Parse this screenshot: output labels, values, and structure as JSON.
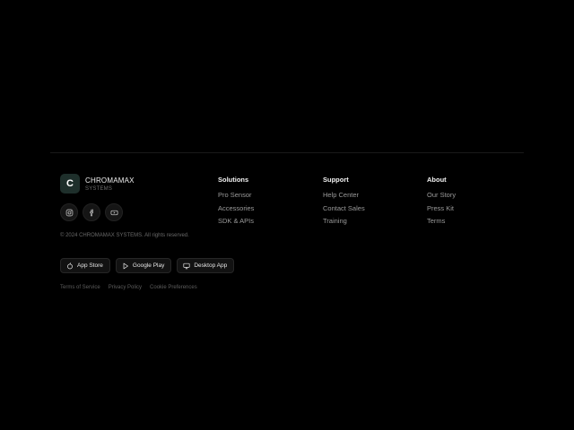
{
  "brand": {
    "mark": "C",
    "name": "CHROMAMAX",
    "sub": "SYSTEMS"
  },
  "socials": [
    {
      "icon": "instagram-icon"
    },
    {
      "icon": "facebook-icon"
    },
    {
      "icon": "youtube-icon"
    }
  ],
  "copyright": "© 2024 CHROMAMAX SYSTEMS. All rights reserved.",
  "columns": [
    {
      "title": "Solutions",
      "links": [
        "Pro Sensor",
        "Accessories",
        "SDK & APIs"
      ]
    },
    {
      "title": "Support",
      "links": [
        "Help Center",
        "Contact Sales",
        "Training"
      ]
    },
    {
      "title": "About",
      "links": [
        "Our Story",
        "Press Kit",
        "Terms"
      ]
    }
  ],
  "apps": [
    {
      "label": "App Store",
      "icon": "apple-icon"
    },
    {
      "label": "Google Play",
      "icon": "play-icon"
    },
    {
      "label": "Desktop App",
      "icon": "monitor-icon"
    }
  ],
  "legal": [
    "Terms of Service",
    "Privacy Policy",
    "Cookie Preferences"
  ],
  "colors": {
    "background": "#000000",
    "logo_bg": "#1e2f2b",
    "link": "#9a9a9a",
    "muted": "#6a6a6a"
  }
}
